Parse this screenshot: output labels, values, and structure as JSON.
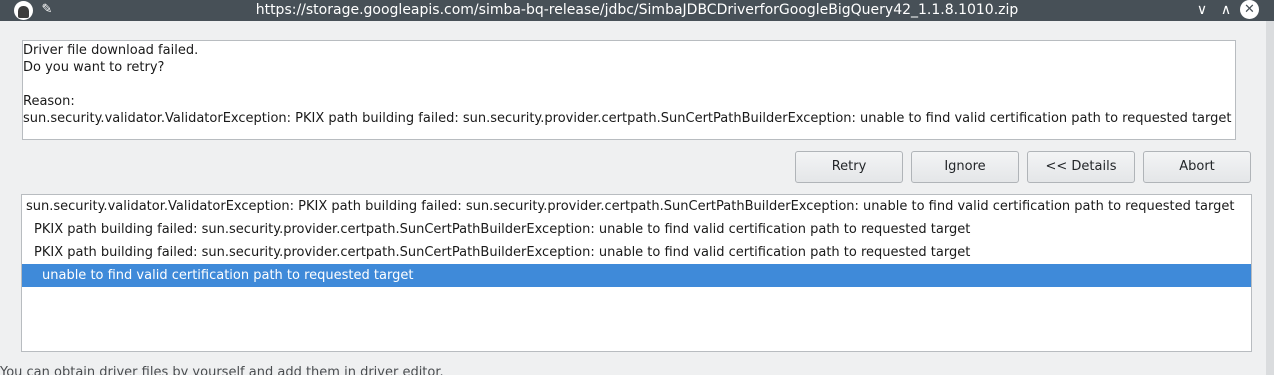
{
  "window": {
    "title": "https://storage.googleapis.com/simba-bq-release/jdbc/SimbaJDBCDriverforGoogleBigQuery42_1.1.8.1010.zip",
    "min_glyph": "∨",
    "max_glyph": "∧",
    "close_glyph": "✕",
    "pin_glyph": "✎"
  },
  "message": {
    "line1": "Driver file download failed.",
    "line2": "Do you want to retry?",
    "reason_label": "Reason:",
    "reason_text": "sun.security.validator.ValidatorException: PKIX path building failed: sun.security.provider.certpath.SunCertPathBuilderException: unable to find valid certification path to requested target"
  },
  "buttons": {
    "retry": "Retry",
    "ignore": "Ignore",
    "details": "<< Details",
    "abort": "Abort"
  },
  "details": {
    "items": [
      "sun.security.validator.ValidatorException: PKIX path building failed: sun.security.provider.certpath.SunCertPathBuilderException: unable to find valid certification path to requested target",
      "PKIX path building failed: sun.security.provider.certpath.SunCertPathBuilderException: unable to find valid certification path to requested target",
      "PKIX path building failed: sun.security.provider.certpath.SunCertPathBuilderException: unable to find valid certification path to requested target",
      "unable to find valid certification path to requested target"
    ],
    "selected_index": 3
  },
  "background_text": "You can obtain driver files by yourself and add them in driver editor.",
  "colors": {
    "titlebar": "#475057",
    "selection": "#3f8ad9",
    "window_bg": "#eff0f1"
  }
}
